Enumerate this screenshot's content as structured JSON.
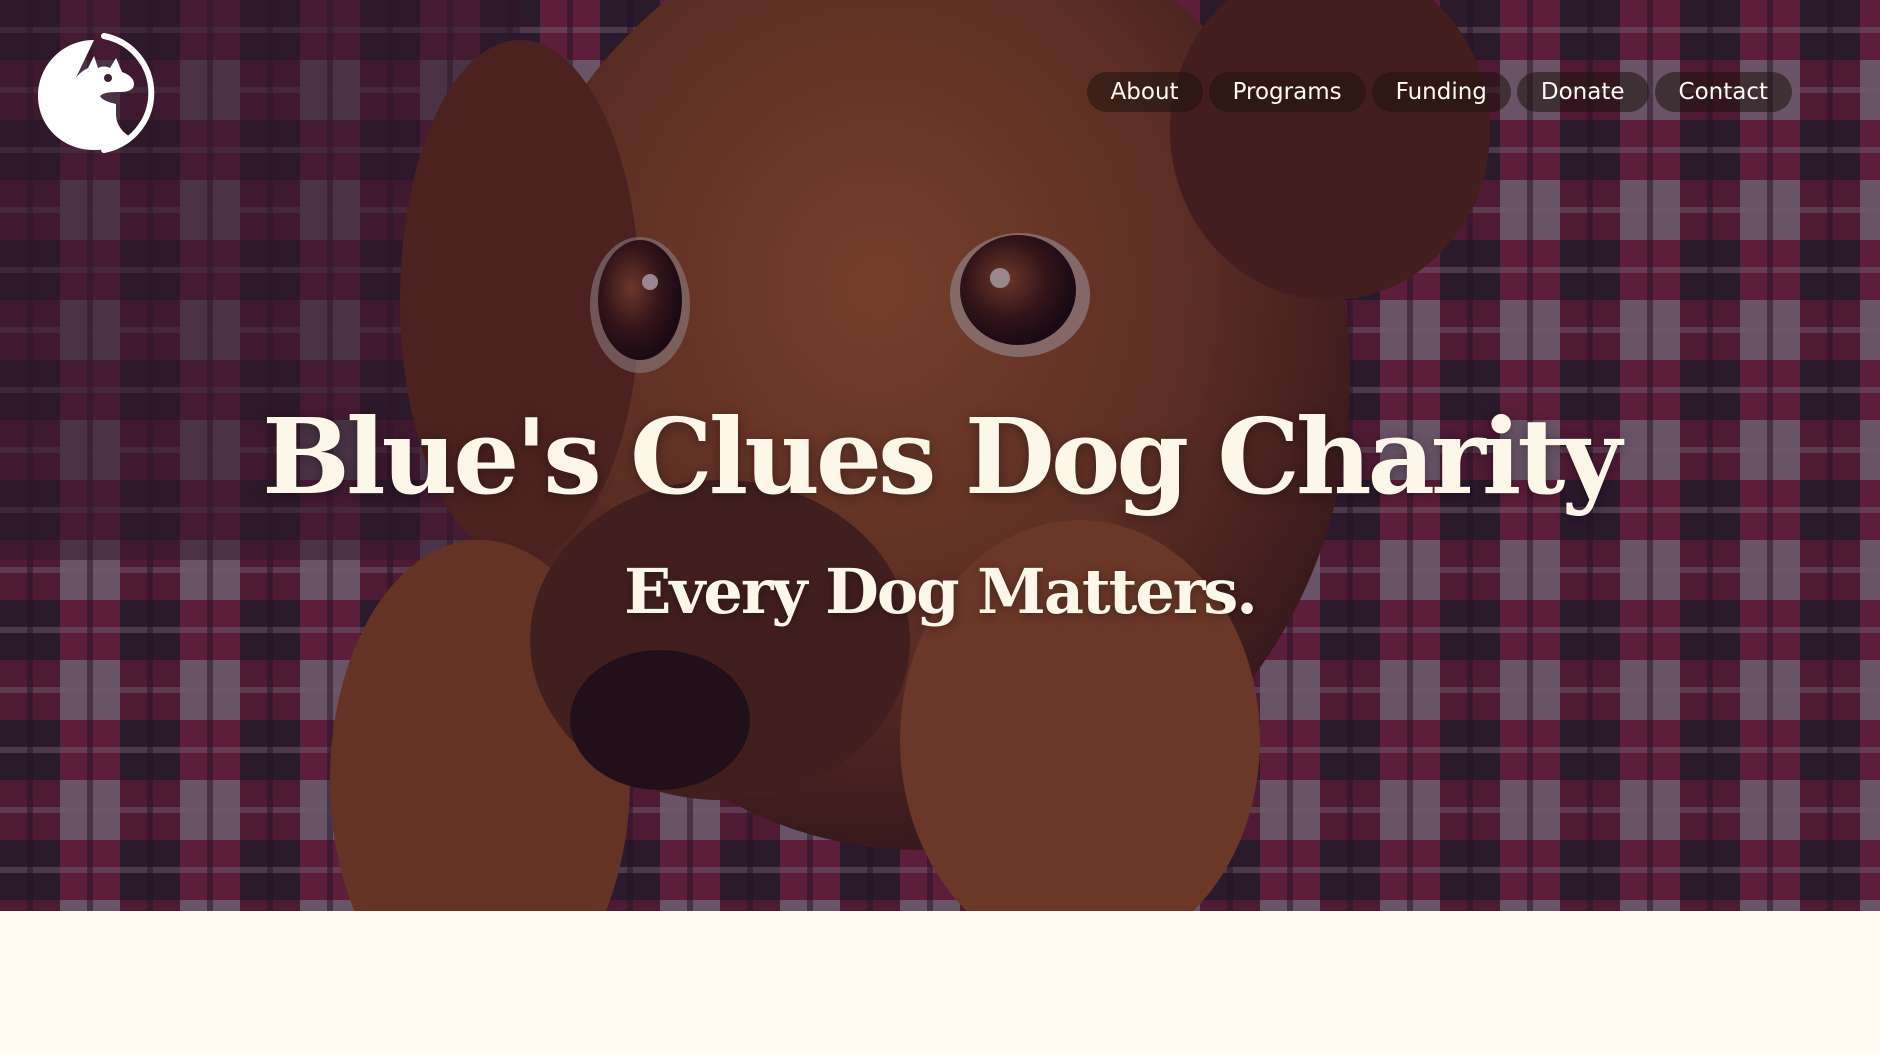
{
  "colors": {
    "overlay": "#260e28",
    "text_cream": "#fdf7ea",
    "page_background": "#fffaf2",
    "dog_fur": "#8a4a22",
    "blanket_red": "#c23a5a",
    "blanket_dark": "#1c1c24"
  },
  "logo": {
    "icon": "dog-head-logo-icon"
  },
  "nav": {
    "items": [
      {
        "label": "About"
      },
      {
        "label": "Programs"
      },
      {
        "label": "Funding"
      },
      {
        "label": "Donate"
      },
      {
        "label": "Contact"
      }
    ]
  },
  "hero": {
    "title": "Blue's Clues Dog Charity",
    "subtitle": "Every Dog Matters.",
    "image": "puppy-on-plaid-blanket"
  }
}
